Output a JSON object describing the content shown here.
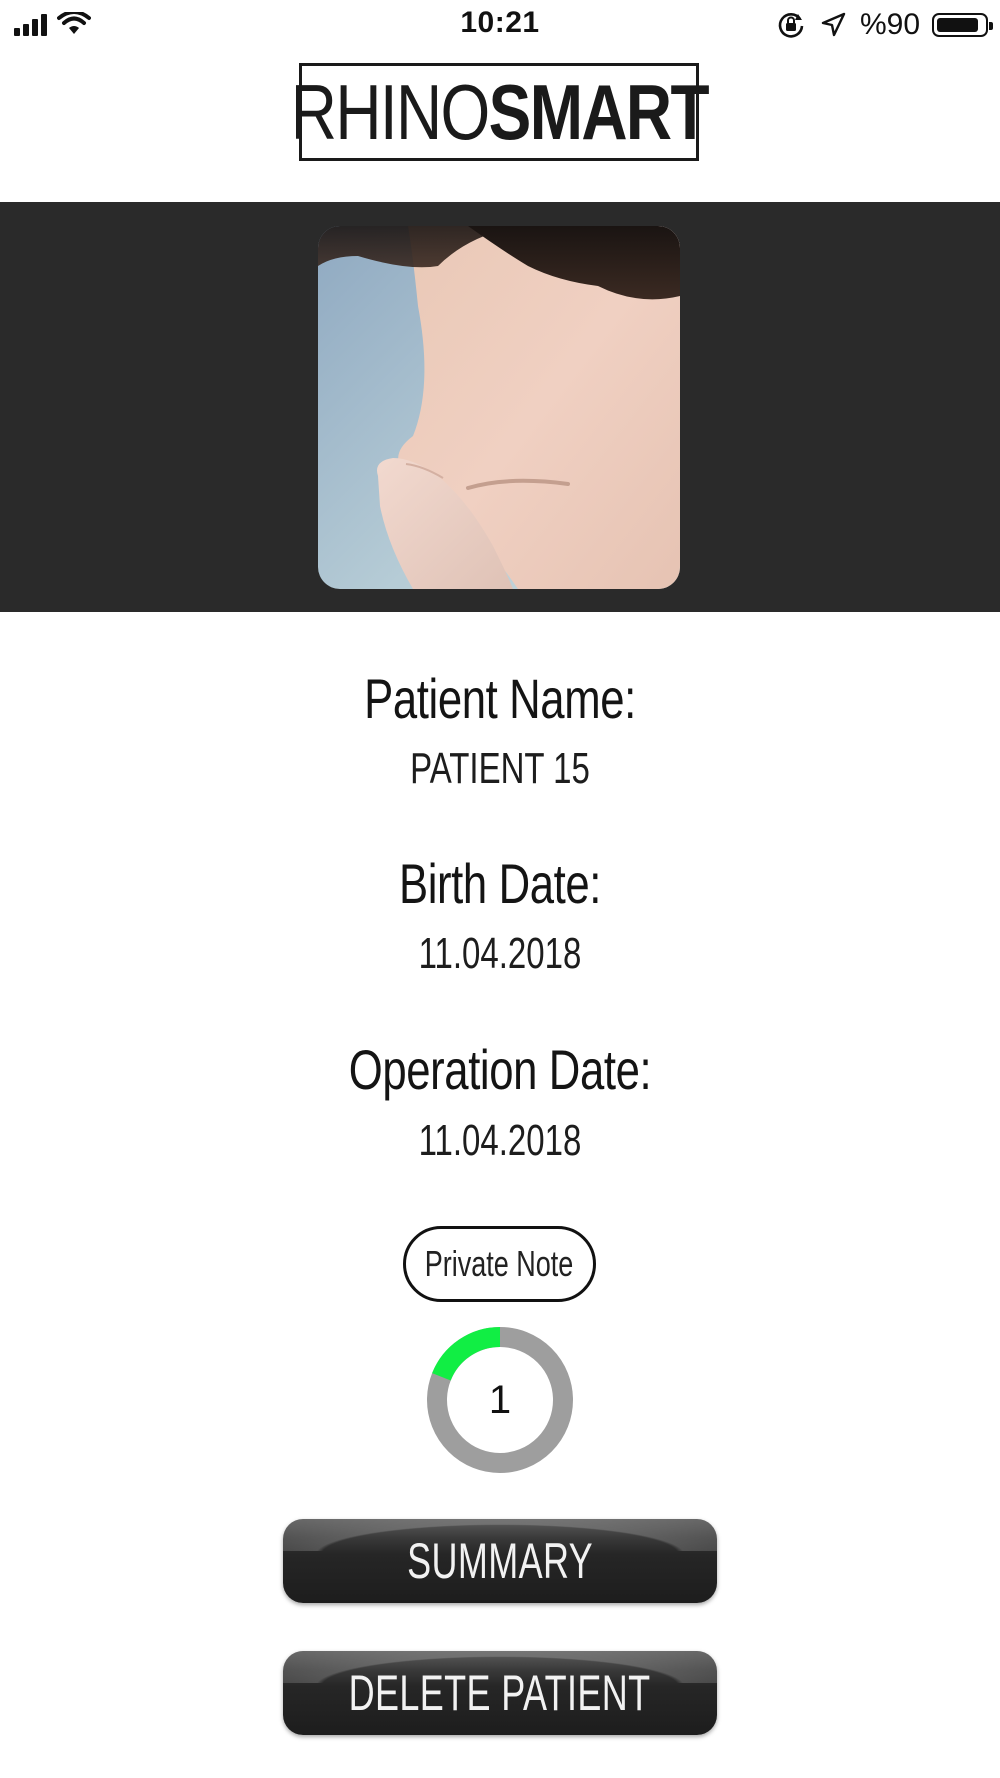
{
  "status_bar": {
    "time": "10:21",
    "battery_percent": "%90",
    "battery_level": 0.9,
    "icons": [
      "cellular-signal-icon",
      "wifi-icon",
      "orientation-lock-icon",
      "location-arrow-icon",
      "battery-icon"
    ]
  },
  "header": {
    "logo_light": "RHINO",
    "logo_bold": "SMART"
  },
  "patient": {
    "photo": "patient-nose-photo",
    "name_label": "Patient Name:",
    "name_value": "PATIENT 15",
    "birth_label": "Birth Date:",
    "birth_value": "11.04.2018",
    "operation_label": "Operation Date:",
    "operation_value": "11.04.2018"
  },
  "actions": {
    "private_note": "Private Note",
    "summary": "SUMMARY",
    "delete": "DELETE PATIENT"
  },
  "progress": {
    "value": "1",
    "fraction": 0.19,
    "colors": {
      "fill": "#11ee44",
      "track": "#9e9e9e"
    }
  }
}
